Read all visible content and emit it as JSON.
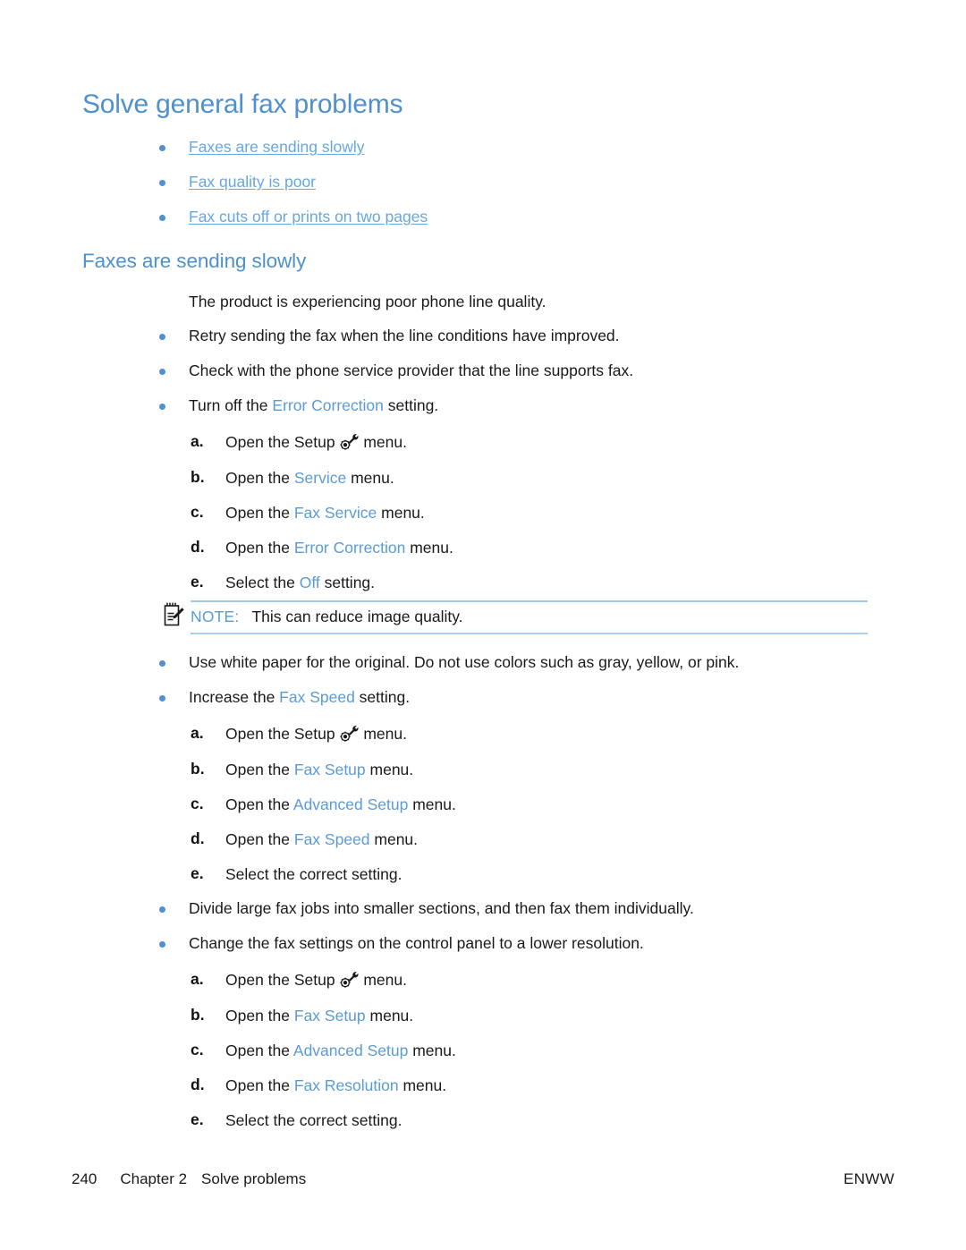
{
  "page": {
    "title": "Solve general fax problems",
    "section_heading": "Faxes are sending slowly",
    "colors": {
      "heading_blue": "#4f90cd",
      "link_blue": "#68a7de",
      "ui_term_blue": "#5b9bd5",
      "rule_blue": "#9dc8e8",
      "body_black": "#1a1a1a"
    }
  },
  "toc": {
    "items": [
      {
        "label": "Faxes are sending slowly"
      },
      {
        "label": "Fax quality is poor"
      },
      {
        "label": "Fax cuts off or prints on two pages"
      }
    ]
  },
  "intro": {
    "text": "The product is experiencing poor phone line quality."
  },
  "bullets": {
    "b1": {
      "text": "Retry sending the fax when the line conditions have improved."
    },
    "b2": {
      "text": "Check with the phone service provider that the line supports fax."
    },
    "b3": {
      "pre": "Turn off the ",
      "term": "Error Correction",
      "post": " setting."
    },
    "b4": {
      "text": "Use white paper for the original. Do not use colors such as gray, yellow, or pink."
    },
    "b5": {
      "pre": "Increase the ",
      "term": "Fax Speed",
      "post": " setting."
    },
    "b6": {
      "text": "Divide large fax jobs into smaller sections, and then fax them individually."
    },
    "b7": {
      "text": "Change the fax settings on the control panel to a lower resolution."
    }
  },
  "steps_error_correction": {
    "a": {
      "marker": "a.",
      "pre": "Open the Setup ",
      "icon": "setup-gear-wrench-icon",
      "post": " menu."
    },
    "b": {
      "marker": "b.",
      "pre": "Open the ",
      "term": "Service",
      "post": " menu."
    },
    "c": {
      "marker": "c.",
      "pre": "Open the ",
      "term": "Fax Service",
      "post": " menu."
    },
    "d": {
      "marker": "d.",
      "pre": "Open the ",
      "term": "Error Correction",
      "post": " menu."
    },
    "e": {
      "marker": "e.",
      "pre": "Select the ",
      "term": "Off",
      "post": " setting."
    }
  },
  "note": {
    "label": "NOTE:",
    "text": "This can reduce image quality.",
    "icon": "notepad-pencil-icon"
  },
  "steps_fax_speed": {
    "a": {
      "marker": "a.",
      "pre": "Open the Setup ",
      "icon": "setup-gear-wrench-icon",
      "post": " menu."
    },
    "b": {
      "marker": "b.",
      "pre": "Open the ",
      "term": "Fax Setup",
      "post": " menu."
    },
    "c": {
      "marker": "c.",
      "pre": "Open the ",
      "term": "Advanced Setup",
      "post": " menu."
    },
    "d": {
      "marker": "d.",
      "pre": "Open the ",
      "term": "Fax Speed",
      "post": " menu."
    },
    "e": {
      "marker": "e.",
      "pre": "Select the correct setting.",
      "term": "",
      "post": ""
    }
  },
  "steps_fax_resolution": {
    "a": {
      "marker": "a.",
      "pre": "Open the Setup ",
      "icon": "setup-gear-wrench-icon",
      "post": " menu."
    },
    "b": {
      "marker": "b.",
      "pre": "Open the ",
      "term": "Fax Setup",
      "post": " menu."
    },
    "c": {
      "marker": "c.",
      "pre": "Open the ",
      "term": "Advanced Setup",
      "post": " menu."
    },
    "d": {
      "marker": "d.",
      "pre": "Open the ",
      "term": "Fax Resolution",
      "post": " menu."
    },
    "e": {
      "marker": "e.",
      "pre": "Select the correct setting.",
      "term": "",
      "post": ""
    }
  },
  "footer": {
    "page_number": "240",
    "chapter": "Chapter 2",
    "chapter_title": "Solve problems",
    "locale": "ENWW"
  }
}
